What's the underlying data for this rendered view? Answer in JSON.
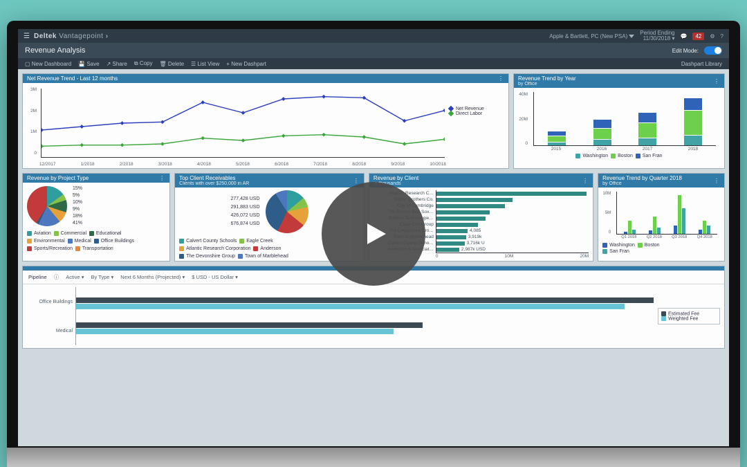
{
  "topbar": {
    "brand1": "Deltek",
    "brand2": "Vantagepoint",
    "firm": "Apple & Bartlett, PC (New PSA)",
    "period_label": "Period Ending",
    "period_value": "11/30/2018",
    "notif_badge": "42"
  },
  "page": {
    "title": "Revenue Analysis",
    "edit_mode_label": "Edit Mode:"
  },
  "toolbar": {
    "new_dash": "New Dashboard",
    "save": "Save",
    "share": "Share",
    "copy": "Copy",
    "delete": "Delete",
    "listview": "List View",
    "new_dashpart": "+ New Dashpart",
    "library": "Dashpart Library"
  },
  "panels": {
    "net": {
      "title": "Net Revenue Trend - Last 12 months",
      "legend": [
        "Net Revenue",
        "Direct Labor"
      ]
    },
    "year": {
      "title": "Revenue Trend by Year",
      "sub": "by Office",
      "legend": [
        "Washington",
        "Boston",
        "San Fran"
      ]
    },
    "ptype": {
      "title": "Revenue by Project Type",
      "slice_labels": [
        "15%",
        "5%",
        "10%",
        "9%",
        "18%",
        "41%"
      ],
      "legend": [
        "Aviation",
        "Commercial",
        "Educational",
        "Environmental",
        "Medical",
        "Office Buildings",
        "Sports/Recreation",
        "Transportation"
      ]
    },
    "recv": {
      "title": "Top Client Receivables",
      "sub": "Clients with over $250,000 in AR",
      "amounts": [
        "277,428 USD",
        "291,883 USD",
        "426,072 USD",
        "676,874 USD"
      ],
      "legend": [
        "Calvert County Schools",
        "Eagle Creek",
        "Atlantic Research Corporation",
        "Anderson",
        "The Devonshire Group",
        "Town of Marblehead"
      ]
    },
    "client": {
      "title": "Revenue by Client",
      "sub": "in thousands",
      "rows": [
        "Atlantic Research C…",
        "Dalton Brothers Co.",
        "City of Cambridge",
        "The Boston Red Sox…",
        "BioMed Technologie…",
        "Cape Cod Group",
        "The Devonshire Gro…",
        "Town of Marblehead",
        "Calvert County Scho…",
        "Anderson & Associat…"
      ],
      "vals": [
        "",
        "",
        "",
        "",
        "",
        "",
        "4,085",
        "3,919k",
        "3,716k U",
        "2,987k USD"
      ],
      "xticks": [
        "0",
        "10M",
        "20M"
      ]
    },
    "qtr": {
      "title": "Revenue Trend by Quarter 2018",
      "sub": "by Office",
      "legend": [
        "Washington",
        "Boston",
        "San Fran"
      ]
    },
    "pipeline": {
      "label": "Pipeline",
      "filters": [
        "Active ▾",
        "By Type ▾",
        "Next 6 Months (Projected) ▾",
        "$ USD - US Dollar ▾"
      ],
      "rows": [
        "Office Buildings",
        "Medical"
      ],
      "legend": [
        "Estimated Fee",
        "Weighted Fee"
      ]
    }
  },
  "chart_data": [
    {
      "id": "net_revenue_trend",
      "type": "line",
      "x": [
        "12/2017",
        "1/2018",
        "2/2018",
        "3/2018",
        "4/2018",
        "5/2018",
        "6/2018",
        "7/2018",
        "8/2018",
        "9/2018",
        "10/2018"
      ],
      "series": [
        {
          "name": "Net Revenue",
          "color": "#2b3fbf",
          "values": [
            1.2,
            1.35,
            1.5,
            1.55,
            2.4,
            1.95,
            2.55,
            2.65,
            2.6,
            1.6,
            2.05
          ]
        },
        {
          "name": "Direct Labor",
          "color": "#3aa63a",
          "values": [
            0.5,
            0.55,
            0.55,
            0.6,
            0.85,
            0.75,
            0.95,
            1.0,
            0.9,
            0.6,
            0.8
          ]
        }
      ],
      "ylabel": "M",
      "ylim": [
        0,
        3
      ],
      "yticks": [
        0,
        "1M",
        "2M",
        "3M"
      ]
    },
    {
      "id": "revenue_by_year",
      "type": "bar",
      "stacked": true,
      "categories": [
        "2015",
        "2016",
        "2017",
        "2018"
      ],
      "series": [
        {
          "name": "Washington",
          "color": "#40a3a6",
          "values": [
            2,
            4,
            5,
            7
          ]
        },
        {
          "name": "Boston",
          "color": "#6cd04b",
          "values": [
            4,
            8,
            11,
            18
          ]
        },
        {
          "name": "San Fran",
          "color": "#2f63b8",
          "values": [
            3,
            6,
            7,
            9
          ]
        }
      ],
      "ylabel": "M",
      "ylim": [
        0,
        40
      ],
      "yticks": [
        "0",
        "20M",
        "40M"
      ]
    },
    {
      "id": "revenue_by_project_type",
      "type": "pie",
      "slices": [
        {
          "name": "Aviation",
          "value": 15,
          "color": "#2e9e9e"
        },
        {
          "name": "Commercial",
          "value": 5,
          "color": "#86c24a"
        },
        {
          "name": "Educational",
          "value": 10,
          "color": "#2f6a46"
        },
        {
          "name": "Environmental",
          "value": 9,
          "color": "#e7a13a"
        },
        {
          "name": "Medical",
          "value": 18,
          "color": "#4d77be"
        },
        {
          "name": "Office Buildings",
          "value": 2,
          "color": "#2e5d8a"
        },
        {
          "name": "Sports/Recreation",
          "value": 41,
          "color": "#c33a3a"
        },
        {
          "name": "Transportation",
          "value": 0,
          "color": "#e68a3a"
        }
      ]
    },
    {
      "id": "top_client_receivables",
      "type": "pie",
      "slices": [
        {
          "name": "Calvert County Schools",
          "value": 277428,
          "color": "#2e9e9e"
        },
        {
          "name": "Eagle Creek",
          "value": 150000,
          "color": "#86c24a"
        },
        {
          "name": "Atlantic Research Corporation",
          "value": 291883,
          "color": "#e7a13a"
        },
        {
          "name": "Anderson",
          "value": 426072,
          "color": "#c33a3a"
        },
        {
          "name": "The Devonshire Group",
          "value": 676874,
          "color": "#2e5d8a"
        },
        {
          "name": "Town of Marblehead",
          "value": 180000,
          "color": "#4d77be"
        }
      ]
    },
    {
      "id": "revenue_by_client",
      "type": "bar",
      "orientation": "horizontal",
      "categories": [
        "Atlantic Research C…",
        "Dalton Brothers Co.",
        "City of Cambridge",
        "The Boston Red Sox…",
        "BioMed Technologie…",
        "Cape Cod Group",
        "The Devonshire Gro…",
        "Town of Marblehead",
        "Calvert County Scho…",
        "Anderson & Associat…"
      ],
      "values": [
        20,
        10,
        9,
        7,
        6.5,
        5.5,
        4.1,
        3.9,
        3.7,
        3.0
      ],
      "xlim": [
        0,
        20
      ],
      "xticks": [
        "0",
        "10M",
        "20M"
      ],
      "unit": "M"
    },
    {
      "id": "revenue_by_quarter_2018",
      "type": "bar",
      "grouped": true,
      "categories": [
        "Q1 2018",
        "Q2 2018",
        "Q3 2018",
        "Q4 2018"
      ],
      "series": [
        {
          "name": "Washington",
          "color": "#2f63b8",
          "values": [
            0.5,
            0.8,
            2,
            1
          ]
        },
        {
          "name": "Boston",
          "color": "#6cd04b",
          "values": [
            3,
            4,
            9,
            3
          ]
        },
        {
          "name": "San Fran",
          "color": "#40a3a6",
          "values": [
            1,
            1.5,
            6,
            2
          ]
        }
      ],
      "ylim": [
        0,
        10
      ],
      "yticks": [
        "0",
        "5M",
        "10M"
      ],
      "ylabel": "M"
    },
    {
      "id": "pipeline",
      "type": "bar",
      "orientation": "horizontal",
      "categories": [
        "Office Buildings",
        "Medical"
      ],
      "series": [
        {
          "name": "Estimated Fee",
          "color": "#3b4a55",
          "values": [
            100,
            60
          ]
        },
        {
          "name": "Weighted Fee",
          "color": "#66c4d6",
          "values": [
            95,
            55
          ]
        }
      ],
      "xlim": [
        0,
        100
      ]
    }
  ]
}
